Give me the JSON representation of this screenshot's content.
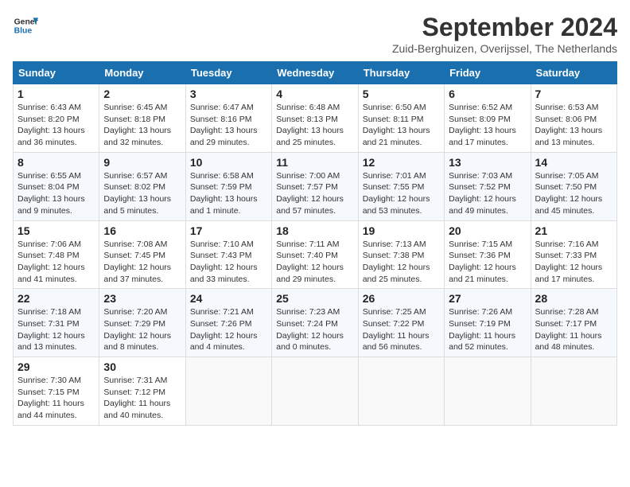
{
  "logo": {
    "line1": "General",
    "line2": "Blue"
  },
  "title": "September 2024",
  "subtitle": "Zuid-Berghuizen, Overijssel, The Netherlands",
  "headers": [
    "Sunday",
    "Monday",
    "Tuesday",
    "Wednesday",
    "Thursday",
    "Friday",
    "Saturday"
  ],
  "weeks": [
    [
      {
        "day": "1",
        "info": "Sunrise: 6:43 AM\nSunset: 8:20 PM\nDaylight: 13 hours\nand 36 minutes."
      },
      {
        "day": "2",
        "info": "Sunrise: 6:45 AM\nSunset: 8:18 PM\nDaylight: 13 hours\nand 32 minutes."
      },
      {
        "day": "3",
        "info": "Sunrise: 6:47 AM\nSunset: 8:16 PM\nDaylight: 13 hours\nand 29 minutes."
      },
      {
        "day": "4",
        "info": "Sunrise: 6:48 AM\nSunset: 8:13 PM\nDaylight: 13 hours\nand 25 minutes."
      },
      {
        "day": "5",
        "info": "Sunrise: 6:50 AM\nSunset: 8:11 PM\nDaylight: 13 hours\nand 21 minutes."
      },
      {
        "day": "6",
        "info": "Sunrise: 6:52 AM\nSunset: 8:09 PM\nDaylight: 13 hours\nand 17 minutes."
      },
      {
        "day": "7",
        "info": "Sunrise: 6:53 AM\nSunset: 8:06 PM\nDaylight: 13 hours\nand 13 minutes."
      }
    ],
    [
      {
        "day": "8",
        "info": "Sunrise: 6:55 AM\nSunset: 8:04 PM\nDaylight: 13 hours\nand 9 minutes."
      },
      {
        "day": "9",
        "info": "Sunrise: 6:57 AM\nSunset: 8:02 PM\nDaylight: 13 hours\nand 5 minutes."
      },
      {
        "day": "10",
        "info": "Sunrise: 6:58 AM\nSunset: 7:59 PM\nDaylight: 13 hours\nand 1 minute."
      },
      {
        "day": "11",
        "info": "Sunrise: 7:00 AM\nSunset: 7:57 PM\nDaylight: 12 hours\nand 57 minutes."
      },
      {
        "day": "12",
        "info": "Sunrise: 7:01 AM\nSunset: 7:55 PM\nDaylight: 12 hours\nand 53 minutes."
      },
      {
        "day": "13",
        "info": "Sunrise: 7:03 AM\nSunset: 7:52 PM\nDaylight: 12 hours\nand 49 minutes."
      },
      {
        "day": "14",
        "info": "Sunrise: 7:05 AM\nSunset: 7:50 PM\nDaylight: 12 hours\nand 45 minutes."
      }
    ],
    [
      {
        "day": "15",
        "info": "Sunrise: 7:06 AM\nSunset: 7:48 PM\nDaylight: 12 hours\nand 41 minutes."
      },
      {
        "day": "16",
        "info": "Sunrise: 7:08 AM\nSunset: 7:45 PM\nDaylight: 12 hours\nand 37 minutes."
      },
      {
        "day": "17",
        "info": "Sunrise: 7:10 AM\nSunset: 7:43 PM\nDaylight: 12 hours\nand 33 minutes."
      },
      {
        "day": "18",
        "info": "Sunrise: 7:11 AM\nSunset: 7:40 PM\nDaylight: 12 hours\nand 29 minutes."
      },
      {
        "day": "19",
        "info": "Sunrise: 7:13 AM\nSunset: 7:38 PM\nDaylight: 12 hours\nand 25 minutes."
      },
      {
        "day": "20",
        "info": "Sunrise: 7:15 AM\nSunset: 7:36 PM\nDaylight: 12 hours\nand 21 minutes."
      },
      {
        "day": "21",
        "info": "Sunrise: 7:16 AM\nSunset: 7:33 PM\nDaylight: 12 hours\nand 17 minutes."
      }
    ],
    [
      {
        "day": "22",
        "info": "Sunrise: 7:18 AM\nSunset: 7:31 PM\nDaylight: 12 hours\nand 13 minutes."
      },
      {
        "day": "23",
        "info": "Sunrise: 7:20 AM\nSunset: 7:29 PM\nDaylight: 12 hours\nand 8 minutes."
      },
      {
        "day": "24",
        "info": "Sunrise: 7:21 AM\nSunset: 7:26 PM\nDaylight: 12 hours\nand 4 minutes."
      },
      {
        "day": "25",
        "info": "Sunrise: 7:23 AM\nSunset: 7:24 PM\nDaylight: 12 hours\nand 0 minutes."
      },
      {
        "day": "26",
        "info": "Sunrise: 7:25 AM\nSunset: 7:22 PM\nDaylight: 11 hours\nand 56 minutes."
      },
      {
        "day": "27",
        "info": "Sunrise: 7:26 AM\nSunset: 7:19 PM\nDaylight: 11 hours\nand 52 minutes."
      },
      {
        "day": "28",
        "info": "Sunrise: 7:28 AM\nSunset: 7:17 PM\nDaylight: 11 hours\nand 48 minutes."
      }
    ],
    [
      {
        "day": "29",
        "info": "Sunrise: 7:30 AM\nSunset: 7:15 PM\nDaylight: 11 hours\nand 44 minutes."
      },
      {
        "day": "30",
        "info": "Sunrise: 7:31 AM\nSunset: 7:12 PM\nDaylight: 11 hours\nand 40 minutes."
      },
      null,
      null,
      null,
      null,
      null
    ]
  ]
}
